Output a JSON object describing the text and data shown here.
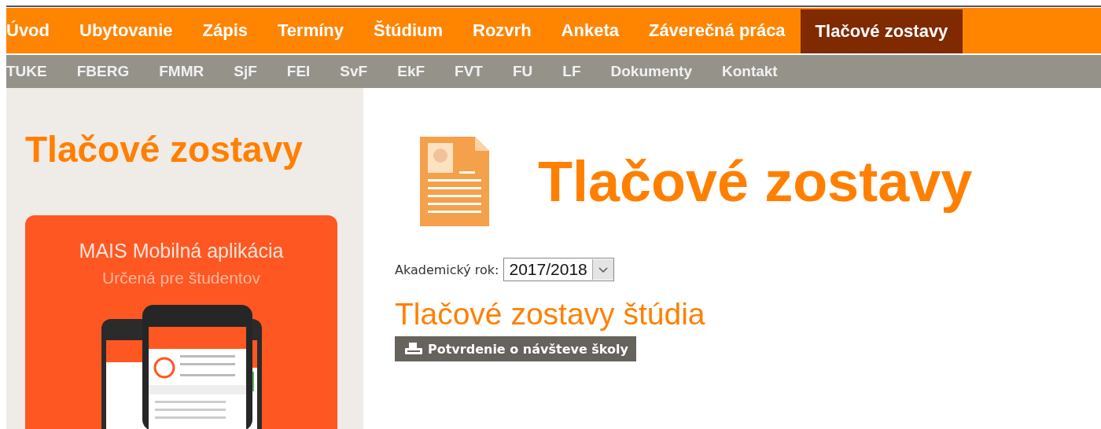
{
  "main_menu": [
    {
      "label": "Úvod",
      "selected": false
    },
    {
      "label": "Ubytovanie",
      "selected": false
    },
    {
      "label": "Zápis",
      "selected": false
    },
    {
      "label": "Termíny",
      "selected": false
    },
    {
      "label": "Štúdium",
      "selected": false
    },
    {
      "label": "Rozvrh",
      "selected": false
    },
    {
      "label": "Anketa",
      "selected": false
    },
    {
      "label": "Záverečná práca",
      "selected": false
    },
    {
      "label": "Tlačové zostavy",
      "selected": true
    }
  ],
  "faculty_menu": [
    "TUKE",
    "FBERG",
    "FMMR",
    "SjF",
    "FEI",
    "SvF",
    "EkF",
    "FVT",
    "FU",
    "LF",
    "Dokumenty",
    "Kontakt"
  ],
  "sidebar": {
    "title": "Tlačové zostavy",
    "banner": {
      "title": "MAIS Mobilná aplikácia",
      "subtitle": "Určená pre študentov"
    }
  },
  "content": {
    "title": "Tlačové zostavy",
    "year_label": "Akademický rok:",
    "year_value": "2017/2018",
    "section_title": "Tlačové zostavy štúdia",
    "buttons": [
      "Potvrdenie o návšteve školy"
    ]
  }
}
